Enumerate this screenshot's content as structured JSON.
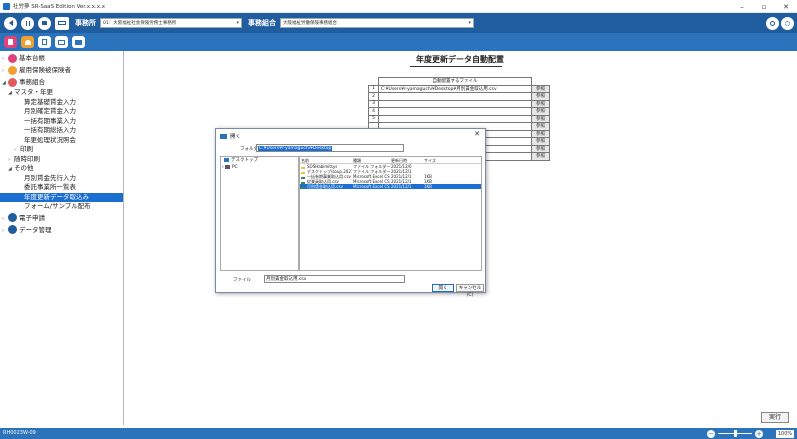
{
  "window": {
    "title": "社労夢 SR-SaaS Edition Ver.x.x.x.x",
    "minimize": "–",
    "maximize": "▫",
    "close": "✕"
  },
  "toolbar": {
    "office_label": "事務所",
    "office_value": "01：大阪福祉社会保険労務士事務所",
    "assoc_label": "事務組合",
    "assoc_value": "大阪福祉労働保険事務組合"
  },
  "sidebar": {
    "items": [
      {
        "label": "基本台帳",
        "level": 0,
        "color": "#e0437a"
      },
      {
        "label": "雇用保険被保険者",
        "level": 0,
        "color": "#f0a030"
      },
      {
        "label": "事務組合",
        "level": 0,
        "color": "#e05a60"
      },
      {
        "label": "マスタ・年更",
        "level": 1
      },
      {
        "label": "算定基礎賃金入力",
        "level": 2
      },
      {
        "label": "月別確定賃金入力",
        "level": 2
      },
      {
        "label": "一括有期事業入力",
        "level": 2
      },
      {
        "label": "一括有期総括入力",
        "level": 2
      },
      {
        "label": "年更処理状況照会",
        "level": 2
      },
      {
        "label": "印刷",
        "level": 2
      },
      {
        "label": "随時印刷",
        "level": 1
      },
      {
        "label": "その他",
        "level": 1
      },
      {
        "label": "月別賃金先行入力",
        "level": 2
      },
      {
        "label": "委託事業所一覧表",
        "level": 2
      },
      {
        "label": "年度更新データ取込み",
        "level": 2
      },
      {
        "label": "フォーム/サンプル配布",
        "level": 2
      },
      {
        "label": "電子申請",
        "level": 0,
        "color": "#1f5d9e"
      },
      {
        "label": "データ管理",
        "level": 0,
        "color": "#1f5d9e"
      }
    ]
  },
  "main": {
    "title": "年度更新データ自動配置",
    "table_header": "自動配置するファイル",
    "rows": [
      {
        "no": "1",
        "file": "C:¥Users¥r-yamaguchi¥Desktop¥月別賃金取込用.csv",
        "btn": "参照"
      },
      {
        "no": "2",
        "file": "",
        "btn": "参照"
      },
      {
        "no": "3",
        "file": "",
        "btn": "参照"
      },
      {
        "no": "4",
        "file": "",
        "btn": "参照"
      },
      {
        "no": "5",
        "file": "",
        "btn": "参照"
      },
      {
        "no": "",
        "file": "",
        "btn": "参照"
      },
      {
        "no": "",
        "file": "",
        "btn": "参照"
      },
      {
        "no": "",
        "file": "",
        "btn": "参照"
      },
      {
        "no": "",
        "file": "",
        "btn": "参照"
      },
      {
        "no": "",
        "file": "",
        "btn": "参照"
      }
    ],
    "exec_label": "実行"
  },
  "dialog": {
    "title": "開く",
    "close": "✕",
    "folder_label": "フォルダ",
    "folder_value": "C:¥Users¥r-yamaguchi¥Desktop",
    "tree": [
      {
        "label": "デスクトップ"
      },
      {
        "label": "PC"
      }
    ],
    "columns": {
      "name": "名前",
      "type": "種類",
      "date": "更新日時",
      "size": "サイズ"
    },
    "files": [
      {
        "name": "SOSHabimitsys",
        "type": "ファイル フォルダー",
        "date": "2021/12/0",
        "size": "",
        "selected": false
      },
      {
        "name": "デスクトップ/soup.20211025",
        "type": "ファイル フォルダー",
        "date": "2021/12/1",
        "size": "",
        "selected": false
      },
      {
        "name": "一括有期事業取込用.csv",
        "type": "Microsoft Excel CS..",
        "date": "2021/12/1",
        "size": "1KB",
        "selected": false
      },
      {
        "name": "従業員取込用.csv",
        "type": "Microsoft Excel CS..",
        "date": "2021/12/1",
        "size": "1KB",
        "selected": false
      },
      {
        "name": "月別賃金取込用.csv",
        "type": "Microsoft Excel CS..",
        "date": "2021/12/1",
        "size": "1KB",
        "selected": true
      }
    ],
    "filename_label": "ファイル",
    "filename_value": "月別賃金取込用.csv",
    "open_label": "開く",
    "cancel_label": "キャンセル(C)"
  },
  "status": {
    "text": "RH0023W-09",
    "zoom": "100%",
    "minus": "−",
    "plus": "+"
  }
}
